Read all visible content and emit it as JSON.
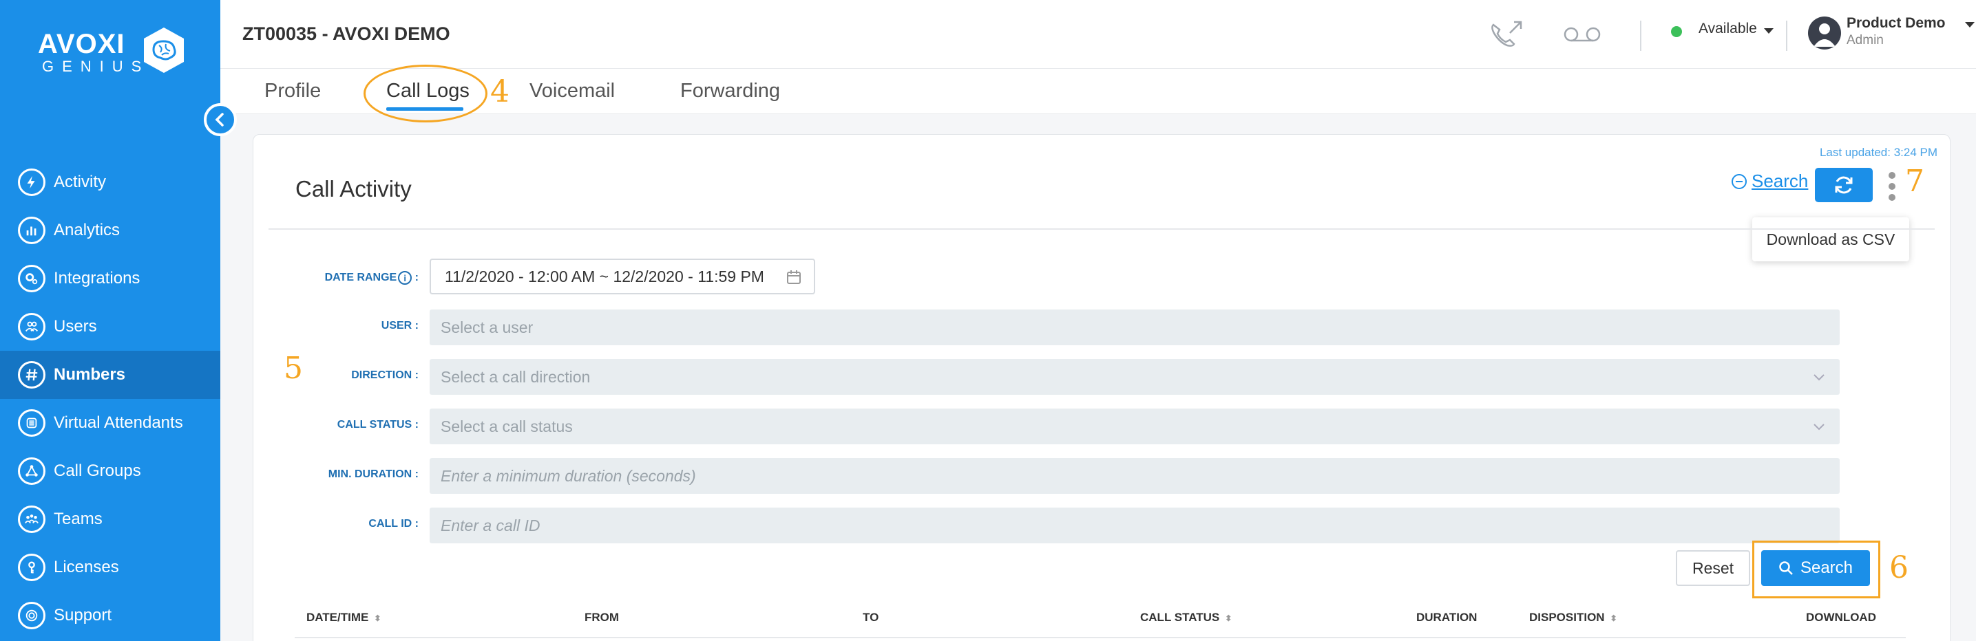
{
  "app": {
    "logo_text": "AVOXI",
    "logo_sub": "GENIUS"
  },
  "sidebar": {
    "items": [
      {
        "label": "Activity",
        "icon": "bolt-icon"
      },
      {
        "label": "Analytics",
        "icon": "bar-chart-icon"
      },
      {
        "label": "Integrations",
        "icon": "gears-icon"
      },
      {
        "label": "Users",
        "icon": "users-icon"
      },
      {
        "label": "Numbers",
        "icon": "hash-icon",
        "active": true
      },
      {
        "label": "Virtual Attendants",
        "icon": "attendant-icon"
      },
      {
        "label": "Call Groups",
        "icon": "call-groups-icon"
      },
      {
        "label": "Teams",
        "icon": "teams-icon"
      },
      {
        "label": "Licenses",
        "icon": "key-icon"
      },
      {
        "label": "Support",
        "icon": "support-icon"
      }
    ]
  },
  "header": {
    "account_title": "ZT00035 - AVOXI DEMO",
    "status": "Available",
    "user_name": "Product Demo",
    "user_role": "Admin"
  },
  "tabs": [
    {
      "label": "Profile"
    },
    {
      "label": "Call Logs",
      "active": true
    },
    {
      "label": "Voicemail"
    },
    {
      "label": "Forwarding"
    }
  ],
  "annotations": {
    "tab": "4",
    "filters": "5",
    "search": "6",
    "menu": "7"
  },
  "card": {
    "last_updated": "Last updated: 3:24 PM",
    "title": "Call Activity",
    "search_link": "Search",
    "download_csv": "Download as CSV"
  },
  "form": {
    "date_range_label": "DATE RANGE",
    "date_range_value": "11/2/2020 - 12:00 AM ~ 12/2/2020 - 11:59 PM",
    "user_label": "USER :",
    "user_placeholder": "Select a user",
    "direction_label": "DIRECTION :",
    "direction_placeholder": "Select a call direction",
    "status_label": "CALL STATUS :",
    "status_placeholder": "Select a call status",
    "min_duration_label": "MIN. DURATION :",
    "min_duration_placeholder": "Enter a minimum duration (seconds)",
    "call_id_label": "CALL ID :",
    "call_id_placeholder": "Enter a call ID",
    "reset_label": "Reset",
    "search_label": "Search"
  },
  "table": {
    "columns": [
      "DATE/TIME",
      "FROM",
      "TO",
      "CALL STATUS",
      "DURATION",
      "DISPOSITION",
      "DOWNLOAD"
    ]
  },
  "colors": {
    "brand": "#1b8fe8",
    "annotation": "#f5a623",
    "online": "#3cc05a"
  }
}
